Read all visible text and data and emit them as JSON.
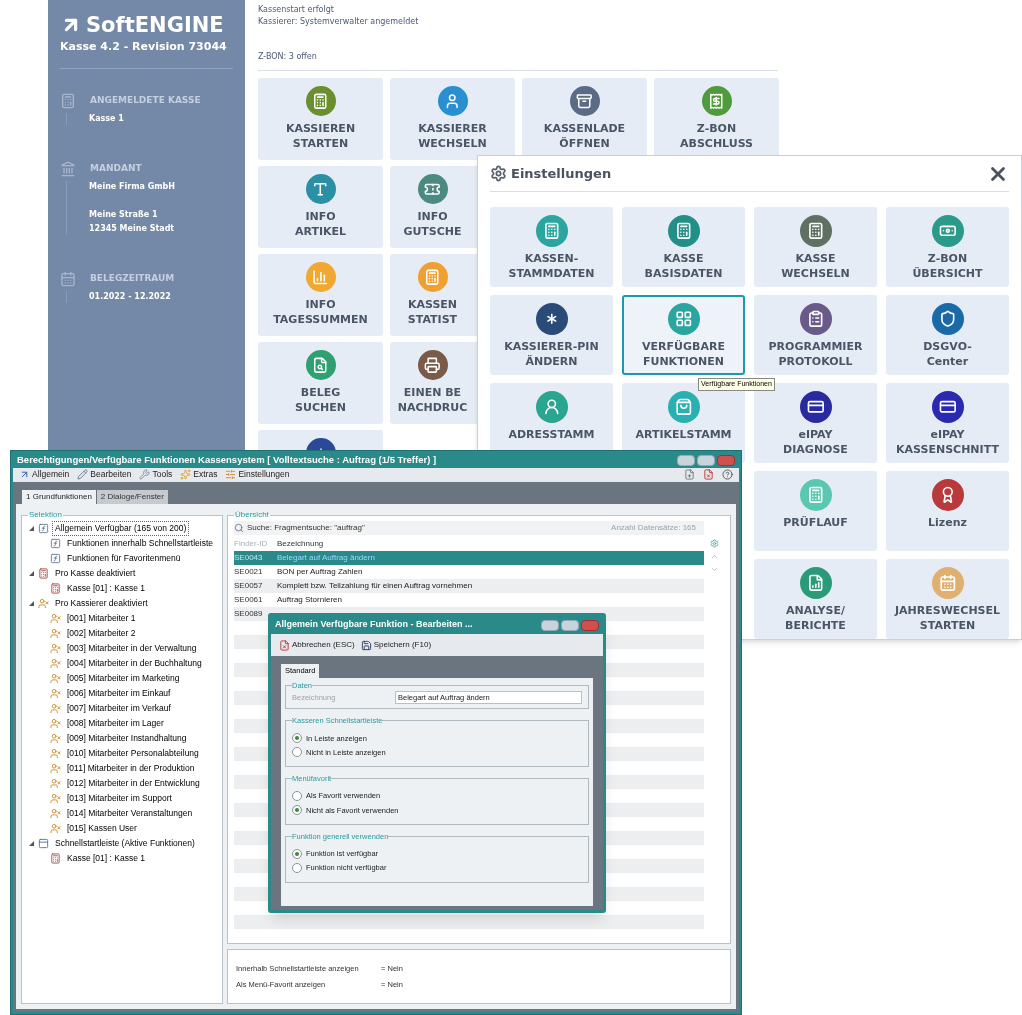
{
  "kasse_app": {
    "sidebar": {
      "logo": "SoftENGINE",
      "version": "Kasse 4.2 - Revision 73044",
      "sections": [
        {
          "heading": "ANGEMELDETE KASSE",
          "kind": "register",
          "groups": [
            [
              "Kasse 1"
            ]
          ]
        },
        {
          "heading": "MANDANT",
          "kind": "building",
          "groups": [
            [
              "Meine Firma GmbH"
            ],
            [
              "Meine Straße 1",
              "12345 Meine Stadt"
            ]
          ]
        },
        {
          "heading": "BELEGZEITRAUM",
          "kind": "calendar",
          "groups": [
            [
              "01.2022 - 12.2022"
            ]
          ]
        }
      ]
    },
    "status_lines": [
      "Kassenstart erfolgt",
      "Kassierer: Systemverwalter angemeldet"
    ],
    "z_bon": "Z-BON: 3 offen",
    "tiles": [
      {
        "lines": [
          "KASSIEREN",
          "STARTEN"
        ],
        "color": "#6b8e2f"
      },
      {
        "lines": [
          "KASSIERER",
          "WECHSELN"
        ],
        "color": "#2a8fd0"
      },
      {
        "lines": [
          "KASSENLADE",
          "ÖFFNEN"
        ],
        "color": "#5b6b85"
      },
      {
        "lines": [
          "Z-BON",
          "ABSCHLUSS"
        ],
        "color": "#4f9a3a"
      },
      {
        "lines": [
          "INFO",
          "ARTIKEL"
        ],
        "color": "#2b8fa6"
      },
      {
        "lines": [
          "INFO",
          "GUTSCHE"
        ],
        "color": "#4a8a80"
      },
      {
        "lines": [
          "INFO",
          "TAGESSUMMEN"
        ],
        "color": "#f0a830"
      },
      {
        "lines": [
          "KASSEN",
          "STATIST"
        ],
        "color": "#f0a030"
      },
      {
        "lines": [
          "BELEG",
          "SUCHEN"
        ],
        "color": "#2fa070"
      },
      {
        "lines": [
          "EINEN BE",
          "NACHDRUC"
        ],
        "color": "#7a5a48"
      }
    ]
  },
  "settings_dialog": {
    "title": "Einstellungen",
    "tiles": [
      {
        "lines": [
          "KASSEN-",
          "STAMMDATEN"
        ],
        "color": "#2aa5a0",
        "selected": false
      },
      {
        "lines": [
          "KASSE",
          "BASISDATEN"
        ],
        "color": "#239088",
        "selected": false
      },
      {
        "lines": [
          "KASSE",
          "WECHSELN"
        ],
        "color": "#5f6f62",
        "selected": false
      },
      {
        "lines": [
          "Z-BON",
          "ÜBERSICHT"
        ],
        "color": "#2a9a8a",
        "selected": false
      },
      {
        "lines": [
          "KASSIERER-PIN",
          "ÄNDERN"
        ],
        "color": "#2a4a78",
        "selected": false
      },
      {
        "lines": [
          "VERFÜGBARE",
          "FUNKTIONEN"
        ],
        "color": "#2aa5a0",
        "selected": true
      },
      {
        "lines": [
          "PROGRAMMIER",
          "PROTOKOLL"
        ],
        "color": "#6a5a8a",
        "selected": false
      },
      {
        "lines": [
          "DSGVO-",
          "Center"
        ],
        "color": "#1a6aa8",
        "selected": false
      },
      {
        "lines": [
          "ADRESSTAMM"
        ],
        "color": "#2aa590",
        "selected": false
      },
      {
        "lines": [
          "ARTIKELSTAMM"
        ],
        "color": "#2ab0b0",
        "selected": false
      },
      {
        "lines": [
          "eIPAY",
          "DIAGNOSE"
        ],
        "color": "#2a2aa0",
        "selected": false
      },
      {
        "lines": [
          "eIPAY",
          "KASSENSCHNITT"
        ],
        "color": "#2a2ab0",
        "selected": false
      },
      {
        "lines": [
          "PRÜFLAUF"
        ],
        "color": "#5ac8b0",
        "selected": false
      },
      {
        "lines": [
          "Lizenz"
        ],
        "color": "#b83a3a",
        "selected": false
      },
      {
        "lines": [
          "ANALYSE/",
          "BERICHTE"
        ],
        "color": "#2a9a78",
        "selected": false
      },
      {
        "lines": [
          "JAHRESWECHSEL",
          "STARTEN"
        ],
        "color": "#e0b070",
        "selected": false
      }
    ],
    "tooltip": "Verfügbare Funktionen"
  },
  "permissions_window": {
    "title": "Berechtigungen/Verfügbare Funktionen Kassensystem [ Volltextsuche : Auftrag (1/5 Treffer) ]",
    "toolbar": [
      "Allgemein",
      "Bearbeiten",
      "Tools",
      "Extras",
      "Einstellungen"
    ],
    "tabs": [
      {
        "label": "1 Grundfunktionen",
        "selected": true
      },
      {
        "label": "2 Dialoge/Fenster",
        "selected": false
      }
    ],
    "selection": {
      "title": "Selektion",
      "tree": [
        {
          "label": "Allgemein Verfügbar (165 von 200)",
          "kind": "function",
          "selected": true,
          "expanded": true,
          "children": [
            {
              "label": "Funktionen innerhalb Schnellstartleiste",
              "kind": "function",
              "selected": false
            },
            {
              "label": "Funktionen für Favoritenmenü",
              "kind": "function",
              "selected": false
            }
          ]
        },
        {
          "label": "Pro Kasse deaktiviert",
          "kind": "register",
          "selected": false,
          "expanded": true,
          "children": [
            {
              "label": "Kasse [01] : Kasse 1",
              "kind": "register",
              "selected": false
            }
          ]
        },
        {
          "label": "Pro Kassierer deaktiviert",
          "kind": "cashier",
          "selected": false,
          "expanded": true,
          "children": [
            {
              "label": "[001] Mitarbeiter 1",
              "kind": "cashier",
              "selected": false
            },
            {
              "label": "[002] Mitarbeiter 2",
              "kind": "cashier",
              "selected": false
            },
            {
              "label": "[003] Mitarbeiter in der Verwaltung",
              "kind": "cashier",
              "selected": false
            },
            {
              "label": "[004] Mitarbeiter in der Buchhaltung",
              "kind": "cashier",
              "selected": false
            },
            {
              "label": "[005] Mitarbeiter im Marketing",
              "kind": "cashier",
              "selected": false
            },
            {
              "label": "[006] Mitarbeiter im Einkauf",
              "kind": "cashier",
              "selected": false
            },
            {
              "label": "[007] Mitarbeiter im Verkauf",
              "kind": "cashier",
              "selected": false
            },
            {
              "label": "[008] Mitarbeiter im Lager",
              "kind": "cashier",
              "selected": false
            },
            {
              "label": "[009] Mitarbeiter Instandhaltung",
              "kind": "cashier",
              "selected": false
            },
            {
              "label": "[010] Mitarbeiter Personalabteilung",
              "kind": "cashier",
              "selected": false
            },
            {
              "label": "[011] Mitarbeiter in der Produktion",
              "kind": "cashier",
              "selected": false
            },
            {
              "label": "[012] Mitarbeiter in der Entwicklung",
              "kind": "cashier",
              "selected": false
            },
            {
              "label": "[013] Mitarbeiter im Support",
              "kind": "cashier",
              "selected": false
            },
            {
              "label": "[014] Mitarbeiter Veranstaltungen",
              "kind": "cashier",
              "selected": false
            },
            {
              "label": "[015] Kassen User",
              "kind": "cashier",
              "selected": false
            }
          ]
        },
        {
          "label": "Schnellstartleiste (Aktive Funktionen)",
          "kind": "toolbar",
          "selected": false,
          "expanded": true,
          "children": [
            {
              "label": "Kasse [01] : Kasse 1",
              "kind": "register_off",
              "selected": false
            }
          ]
        }
      ]
    },
    "overview": {
      "title": "Übersicht",
      "search": "Suche: Fragmentsuche: \"auftrag\"",
      "count": "Anzahl Datensätze: 165",
      "columns": [
        "Finder-ID",
        "Bezeichnung"
      ],
      "rows": [
        {
          "id": "SE0043",
          "text": "Belegart auf Auftrag ändern",
          "selected": true
        },
        {
          "id": "SE0021",
          "text": "BON per Auftrag Zahlen",
          "selected": false
        },
        {
          "id": "SE0057",
          "text": "Komplett bzw. Teilzahlung für einen Auftrag vornehmen",
          "selected": false
        },
        {
          "id": "SE0061",
          "text": "Auftrag Stornieren",
          "selected": false
        },
        {
          "id": "SE0089",
          "selected": false
        }
      ]
    },
    "info": [
      {
        "label": "Innerhalb Schnellstartleiste anzeigen",
        "value": "= Nein"
      },
      {
        "label": "Als Menü-Favorit anzeigen",
        "value": "= Nein"
      }
    ]
  },
  "edit_dialog": {
    "title": "Allgemein Verfügbare Funktion - Bearbeiten ...",
    "toolbar": [
      "Abbrechen (ESC)",
      "Speichern (F10)"
    ],
    "tab": "Standard",
    "data_group": {
      "title": "Daten",
      "label": "Bezeichnung",
      "value": "Belegart auf Auftrag ändern"
    },
    "radio_groups": [
      {
        "title": "Kasseren Schnellstartleiste",
        "options": [
          {
            "label": "In Leiste anzeigen",
            "selected": true
          },
          {
            "label": "Nicht in Leiste anzeigen",
            "selected": false
          }
        ]
      },
      {
        "title": "Menüfavorit",
        "options": [
          {
            "label": "Als Favorit verwenden",
            "selected": false
          },
          {
            "label": "Nicht als Favorit verwenden",
            "selected": true
          }
        ]
      },
      {
        "title": "Funktion generell verwenden",
        "options": [
          {
            "label": "Funktion ist verfügbar",
            "selected": true
          },
          {
            "label": "Funktion nicht verfügbar",
            "selected": false
          }
        ]
      }
    ]
  }
}
